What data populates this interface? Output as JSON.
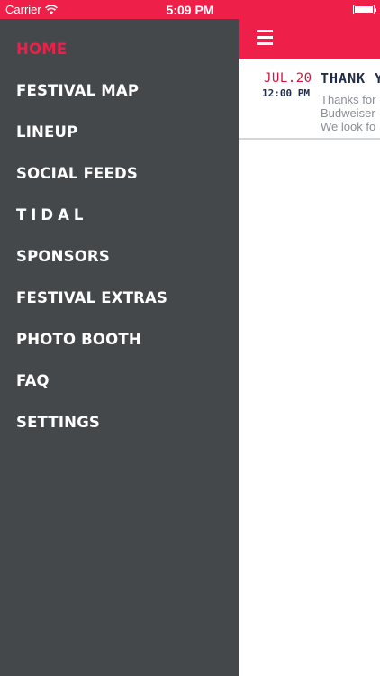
{
  "status_bar": {
    "carrier": "Carrier",
    "time": "5:09 PM"
  },
  "menu": {
    "items": [
      {
        "label": "HOME",
        "active": true
      },
      {
        "label": "FESTIVAL MAP"
      },
      {
        "label": "LINEUP"
      },
      {
        "label": "SOCIAL FEEDS"
      },
      {
        "label": "TIDAL"
      },
      {
        "label": "SPONSORS"
      },
      {
        "label": "FESTIVAL EXTRAS"
      },
      {
        "label": "PHOTO BOOTH"
      },
      {
        "label": "FAQ"
      },
      {
        "label": "SETTINGS"
      }
    ]
  },
  "feed": {
    "post": {
      "date": "JUL.20",
      "time": "12:00 PM",
      "title": "THANK Y",
      "body_line1": "Thanks for",
      "body_line2": "Budweiser",
      "body_line3": "We look fo"
    }
  },
  "colors": {
    "accent": "#ee2049",
    "drawer": "#45484b",
    "navy": "#1f2c4a"
  }
}
